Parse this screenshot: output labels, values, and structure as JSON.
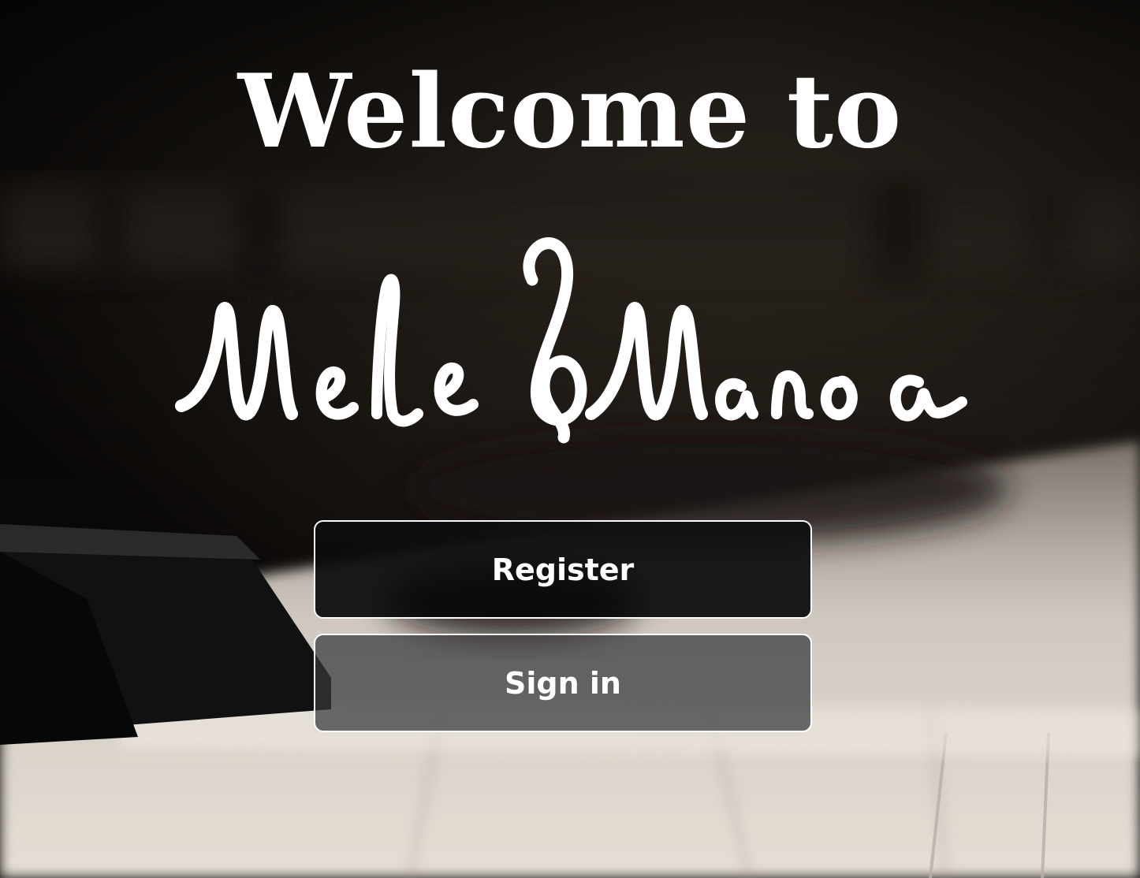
{
  "page": {
    "heading": "Welcome to",
    "brand_logo_text": "Mele & Manoa",
    "background": "piano-keys-photo"
  },
  "actions": {
    "register_label": "Register",
    "signin_label": "Sign in"
  },
  "colors": {
    "text": "#ffffff",
    "button_border": "#ffffff",
    "register_bg": "#0a0a0c",
    "signin_bg": "#38383a"
  }
}
